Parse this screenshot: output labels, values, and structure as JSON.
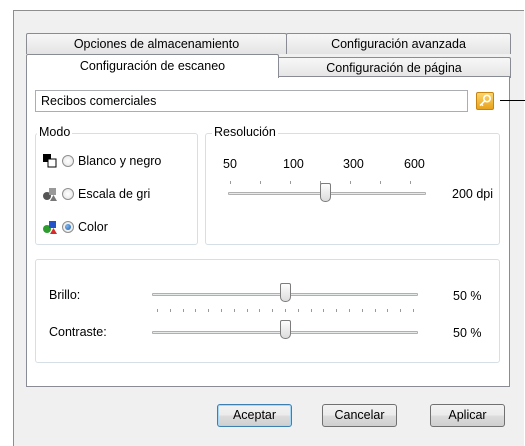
{
  "tabs": {
    "row_back": [
      "Opciones de almacenamiento",
      "Configuración avanzada"
    ],
    "row_front": [
      "Configuración de escaneo",
      "Configuración de página"
    ],
    "active": "Configuración de escaneo"
  },
  "profile_name": {
    "value": "Recibos comerciales"
  },
  "mode": {
    "title": "Modo",
    "options": [
      {
        "label": "Blanco y negro",
        "icon": "black-white-icon",
        "selected": false
      },
      {
        "label": "Escala de grises",
        "icon": "grayscale-icon",
        "selected": false
      },
      {
        "label": "Color",
        "icon": "color-icon",
        "selected": true
      }
    ]
  },
  "resolution": {
    "title": "Resolución",
    "ticks": [
      "50",
      "100",
      "300",
      "600"
    ],
    "value_label": "200 dpi",
    "value": 200
  },
  "adjust": {
    "brightness_label": "Brillo:",
    "brightness_value": "50 %",
    "brightness_fraction": 0.5,
    "contrast_label": "Contraste:",
    "contrast_value": "50 %",
    "contrast_fraction": 0.5
  },
  "buttons": {
    "ok": "Aceptar",
    "cancel": "Cancelar",
    "apply": "Aplicar"
  },
  "icons": {
    "key": "key-icon"
  },
  "colors": {
    "accent": "#3c7fb1",
    "key_button": "#f0b43a"
  }
}
